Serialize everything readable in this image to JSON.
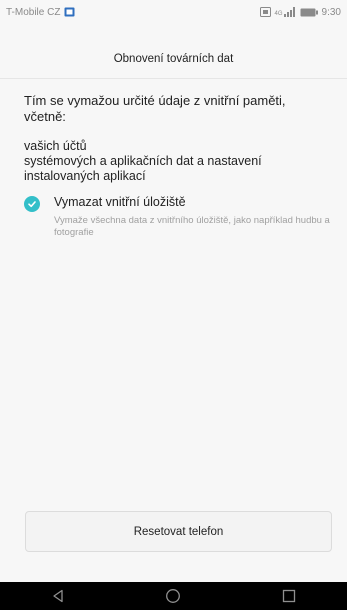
{
  "status_bar": {
    "carrier": "T-Mobile CZ",
    "time": "9:30",
    "network_label": "4G",
    "icons": [
      "notification-icon",
      "sim-icon",
      "signal-icon",
      "battery-icon"
    ]
  },
  "header": {
    "title": "Obnovení továrních dat"
  },
  "content": {
    "description": "Tím se vymažou určité údaje z vnitřní paměti, včetně:",
    "items": [
      "vašich účtů",
      "systémových a aplikačních dat a nastavení instalovaných aplikací"
    ],
    "option": {
      "label": "Vymazat vnitřní úložiště",
      "sublabel": "Vymaže všechna data z vnitřního úložiště, jako například hudbu a fotografie",
      "checked": true
    }
  },
  "reset_button": {
    "label": "Resetovat telefon"
  },
  "nav": {
    "icons": [
      "back-icon",
      "home-icon",
      "recents-icon"
    ]
  },
  "colors": {
    "accent": "#33bfc9",
    "background": "#f7f7f7",
    "navbar": "#000000"
  }
}
